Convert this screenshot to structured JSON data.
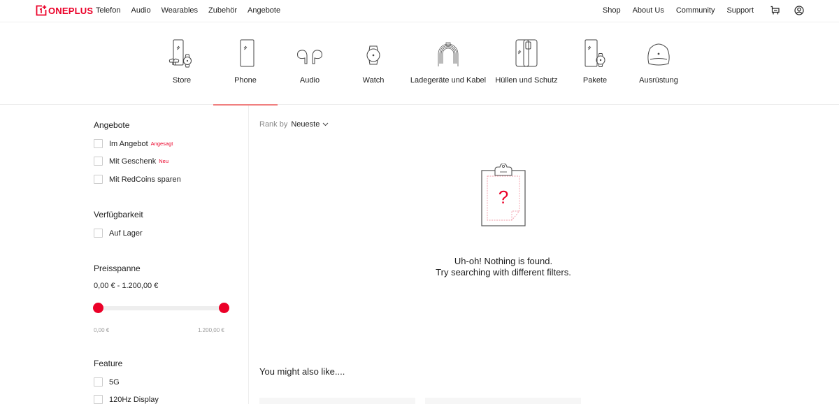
{
  "brand": {
    "name": "ONEPLUS",
    "accent": "#eb0028"
  },
  "topnav": {
    "left": [
      "Telefon",
      "Audio",
      "Wearables",
      "Zubehör",
      "Angebote"
    ],
    "right": [
      "Shop",
      "About Us",
      "Community",
      "Support"
    ],
    "icons": [
      "cart-icon",
      "user-icon"
    ]
  },
  "categories": [
    {
      "label": "Store",
      "icon": "store-icon",
      "active": false
    },
    {
      "label": "Phone",
      "icon": "phone-icon",
      "active": true
    },
    {
      "label": "Audio",
      "icon": "earbuds-icon",
      "active": false
    },
    {
      "label": "Watch",
      "icon": "watch-icon",
      "active": false
    },
    {
      "label": "Ladegeräte und Kabel",
      "icon": "cable-icon",
      "active": false
    },
    {
      "label": "Hüllen und Schutz",
      "icon": "case-icon",
      "active": false
    },
    {
      "label": "Pakete",
      "icon": "bundle-icon",
      "active": false
    },
    {
      "label": "Ausrüstung",
      "icon": "backpack-icon",
      "active": false
    }
  ],
  "filters": {
    "offers": {
      "title": "Angebote",
      "items": [
        {
          "label": "Im Angebot",
          "badge": "Angesagt",
          "checked": false
        },
        {
          "label": "Mit Geschenk",
          "badge": "Neu",
          "checked": false
        },
        {
          "label": "Mit RedCoins sparen",
          "badge": "",
          "checked": false
        }
      ]
    },
    "availability": {
      "title": "Verfügbarkeit",
      "items": [
        {
          "label": "Auf Lager",
          "checked": false
        }
      ]
    },
    "price": {
      "title": "Preisspanne",
      "range_text": "0,00 € - 1.200,00 €",
      "min_label": "0,00 €",
      "max_label": "1.200,00 €",
      "selected_min_fraction": 0,
      "selected_max_fraction": 1
    },
    "feature": {
      "title": "Feature",
      "items": [
        {
          "label": "5G",
          "checked": false
        },
        {
          "label": "120Hz Display",
          "checked": false
        }
      ]
    }
  },
  "main": {
    "rank_label": "Rank by",
    "rank_value": "Neueste",
    "empty_line1": "Uh-oh! Nothing is found.",
    "empty_line2": "Try searching with different filters.",
    "also_like": "You might also like...."
  }
}
